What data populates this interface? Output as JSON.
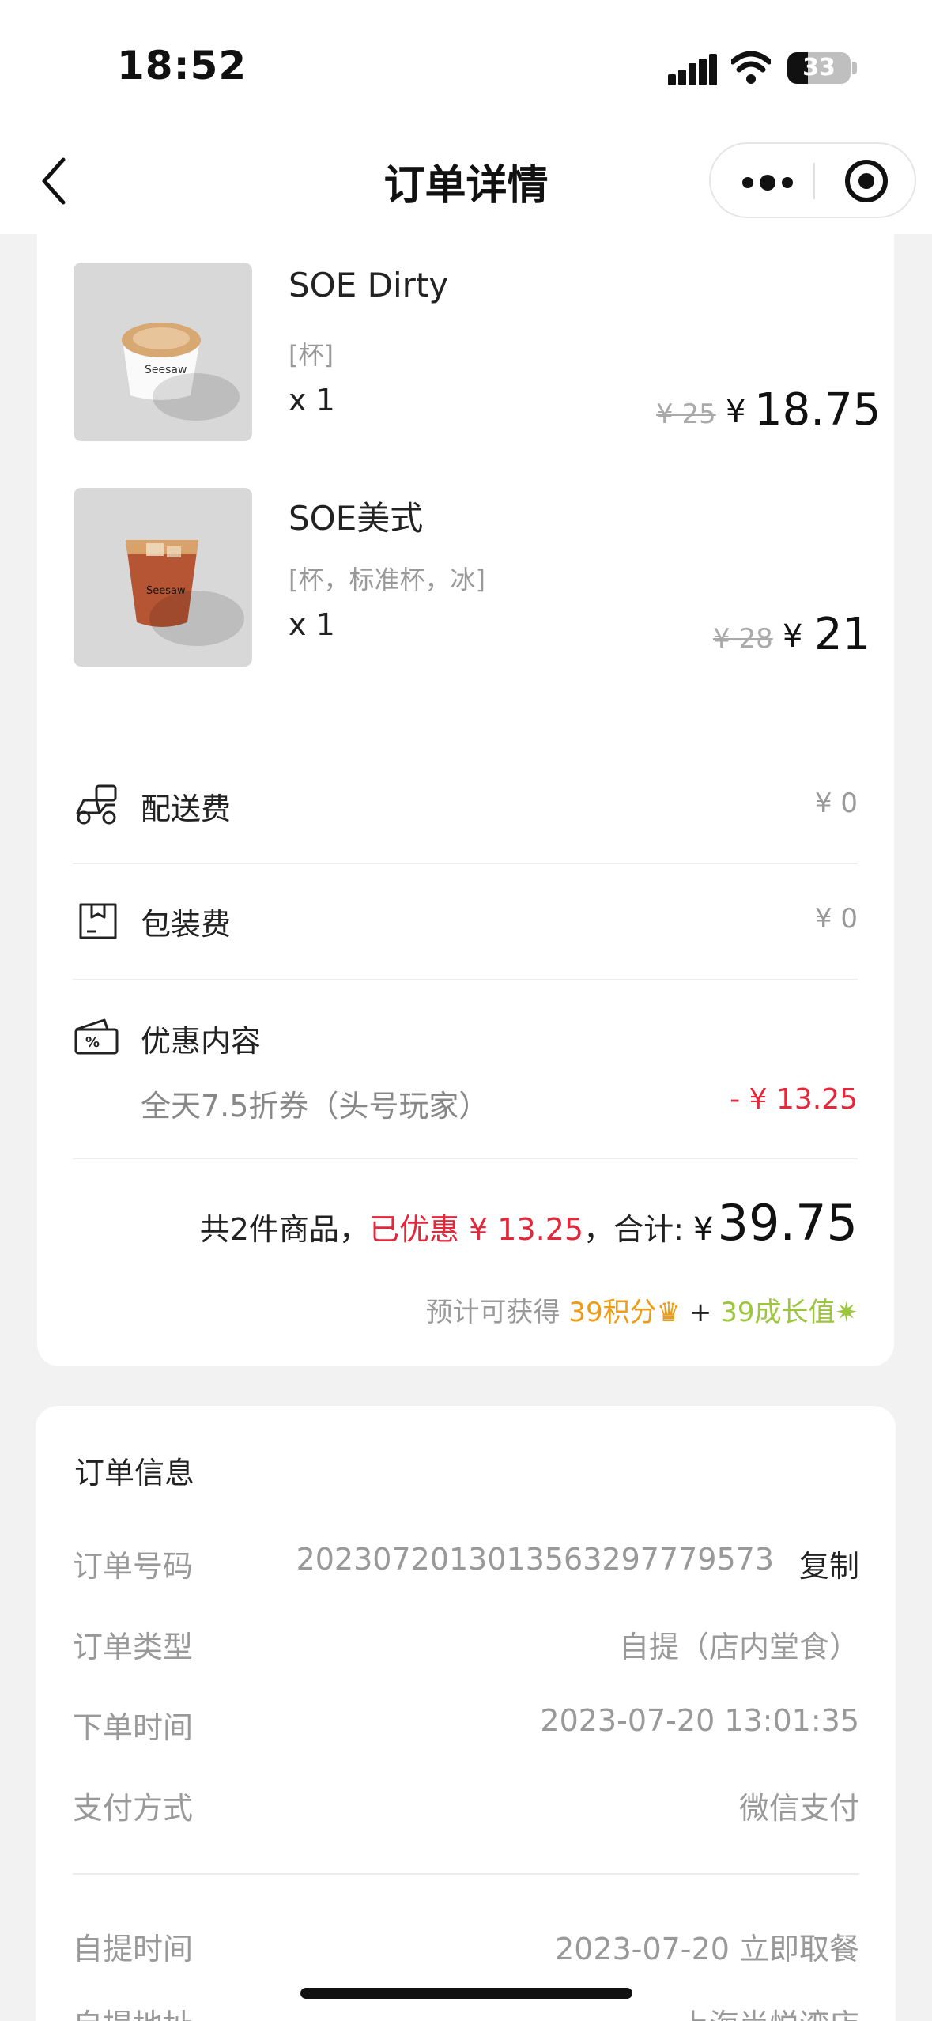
{
  "status_bar": {
    "time": "18:52",
    "battery": "33",
    "battery_level": 0.33
  },
  "nav": {
    "title": "订单详情"
  },
  "items": [
    {
      "name": "SOE Dirty",
      "spec": "[杯]",
      "qty": "x 1",
      "orig_price": "¥ 25",
      "currency": "¥",
      "price": "18.75"
    },
    {
      "name": "SOE美式",
      "spec": "[杯，标准杯，冰]",
      "qty": "x 1",
      "orig_price": "¥ 28",
      "currency": "¥",
      "price": "21"
    }
  ],
  "fees": {
    "delivery": {
      "label": "配送费",
      "value": "¥ 0"
    },
    "packaging": {
      "label": "包装费",
      "value": "¥ 0"
    }
  },
  "discount": {
    "label": "优惠内容",
    "description": "全天7.5折券（头号玩家）",
    "amount": "- ¥ 13.25"
  },
  "summary": {
    "count_text": "共2件商品，",
    "discount_text": "已优惠 ¥ 13.25",
    "total_label": "，合计: ",
    "currency": "¥",
    "total": "39.75"
  },
  "points": {
    "prefix": "预计可获得 ",
    "points_text": "39积分",
    "plus": " + ",
    "growth_text": "39成长值",
    "points_color": "#ef9b14",
    "growth_color": "#9cc63b"
  },
  "order_info": {
    "title": "订单信息",
    "rows": [
      {
        "label": "订单号码",
        "value": "2023072013013563297779573"
      },
      {
        "label": "订单类型",
        "value": "自提（店内堂食）"
      },
      {
        "label": "下单时间",
        "value": "2023-07-20 13:01:35"
      },
      {
        "label": "支付方式",
        "value": "微信支付"
      }
    ],
    "copy_label": "复制",
    "pickup": [
      {
        "label": "自提时间",
        "value": "2023-07-20 立即取餐"
      },
      {
        "label": "自提地址",
        "value": "上海尚悦湾店"
      }
    ]
  },
  "colors": {
    "accent_red": "#e4283c",
    "background": "#f2f2f2"
  }
}
